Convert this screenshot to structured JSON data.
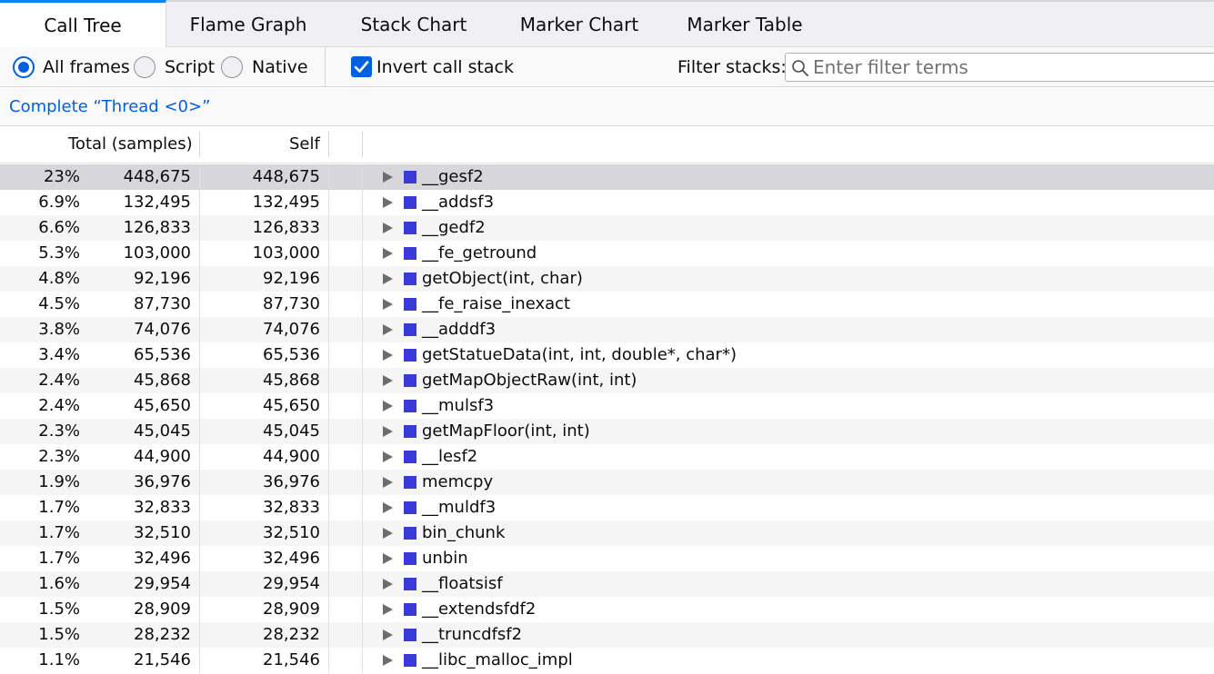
{
  "tabs": [
    {
      "label": "Call Tree",
      "selected": true
    },
    {
      "label": "Flame Graph",
      "selected": false
    },
    {
      "label": "Stack Chart",
      "selected": false
    },
    {
      "label": "Marker Chart",
      "selected": false
    },
    {
      "label": "Marker Table",
      "selected": false
    }
  ],
  "settings": {
    "radio_all_frames": "All frames",
    "radio_script": "Script",
    "radio_native": "Native",
    "selected_radio": "All frames",
    "invert_label": "Invert call stack",
    "invert_checked": true,
    "filter_label": "Filter stacks:",
    "filter_placeholder": "Enter filter terms",
    "filter_value": ""
  },
  "breadcrumb": {
    "label": "Complete “Thread <0>”"
  },
  "tree": {
    "header_total": "Total (samples)",
    "header_self": "Self",
    "category_color": "#3a3ad9",
    "rows": [
      {
        "pct": "23%",
        "total": "448,675",
        "self": "448,675",
        "name": "__gesf2"
      },
      {
        "pct": "6.9%",
        "total": "132,495",
        "self": "132,495",
        "name": "__addsf3"
      },
      {
        "pct": "6.6%",
        "total": "126,833",
        "self": "126,833",
        "name": "__gedf2"
      },
      {
        "pct": "5.3%",
        "total": "103,000",
        "self": "103,000",
        "name": "__fe_getround"
      },
      {
        "pct": "4.8%",
        "total": "92,196",
        "self": "92,196",
        "name": "getObject(int, char)"
      },
      {
        "pct": "4.5%",
        "total": "87,730",
        "self": "87,730",
        "name": "__fe_raise_inexact"
      },
      {
        "pct": "3.8%",
        "total": "74,076",
        "self": "74,076",
        "name": "__adddf3"
      },
      {
        "pct": "3.4%",
        "total": "65,536",
        "self": "65,536",
        "name": "getStatueData(int, int, double*, char*)"
      },
      {
        "pct": "2.4%",
        "total": "45,868",
        "self": "45,868",
        "name": "getMapObjectRaw(int, int)"
      },
      {
        "pct": "2.4%",
        "total": "45,650",
        "self": "45,650",
        "name": "__mulsf3"
      },
      {
        "pct": "2.3%",
        "total": "45,045",
        "self": "45,045",
        "name": "getMapFloor(int, int)"
      },
      {
        "pct": "2.3%",
        "total": "44,900",
        "self": "44,900",
        "name": "__lesf2"
      },
      {
        "pct": "1.9%",
        "total": "36,976",
        "self": "36,976",
        "name": "memcpy"
      },
      {
        "pct": "1.7%",
        "total": "32,833",
        "self": "32,833",
        "name": "__muldf3"
      },
      {
        "pct": "1.7%",
        "total": "32,510",
        "self": "32,510",
        "name": "bin_chunk"
      },
      {
        "pct": "1.7%",
        "total": "32,496",
        "self": "32,496",
        "name": "unbin"
      },
      {
        "pct": "1.6%",
        "total": "29,954",
        "self": "29,954",
        "name": "__floatsisf"
      },
      {
        "pct": "1.5%",
        "total": "28,909",
        "self": "28,909",
        "name": "__extendsfdf2"
      },
      {
        "pct": "1.5%",
        "total": "28,232",
        "self": "28,232",
        "name": "__truncdfsf2"
      },
      {
        "pct": "1.1%",
        "total": "21,546",
        "self": "21,546",
        "name": "__libc_malloc_impl"
      }
    ]
  }
}
